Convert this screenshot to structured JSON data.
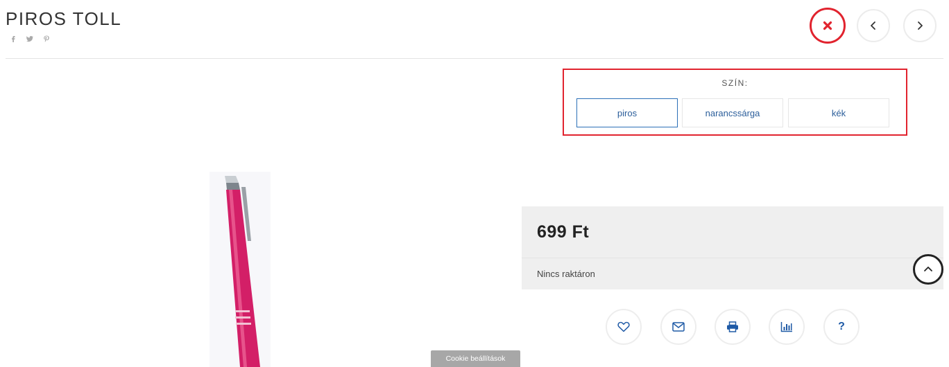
{
  "product": {
    "title": "PIROS TOLL",
    "price": "699 Ft",
    "stock_status": "Nincs raktáron"
  },
  "social": {
    "icons": [
      "facebook-icon",
      "twitter-icon",
      "pinterest-icon"
    ]
  },
  "navigation": {
    "icons": [
      "close-icon",
      "chevron-left-icon",
      "chevron-right-icon"
    ],
    "close_color": "#e1232e"
  },
  "variant": {
    "label": "SZÍN:",
    "options": [
      "piros",
      "narancssárga",
      "kék"
    ],
    "selected": "piros"
  },
  "actions": {
    "icons": [
      "heart-icon",
      "envelope-icon",
      "print-icon",
      "chart-icon",
      "help-icon"
    ],
    "help_glyph": "?",
    "accent_color": "#1f5aa6"
  },
  "scroll_top": {
    "icon": "chevron-up-icon"
  },
  "cookie": {
    "label": "Cookie beállítások"
  }
}
